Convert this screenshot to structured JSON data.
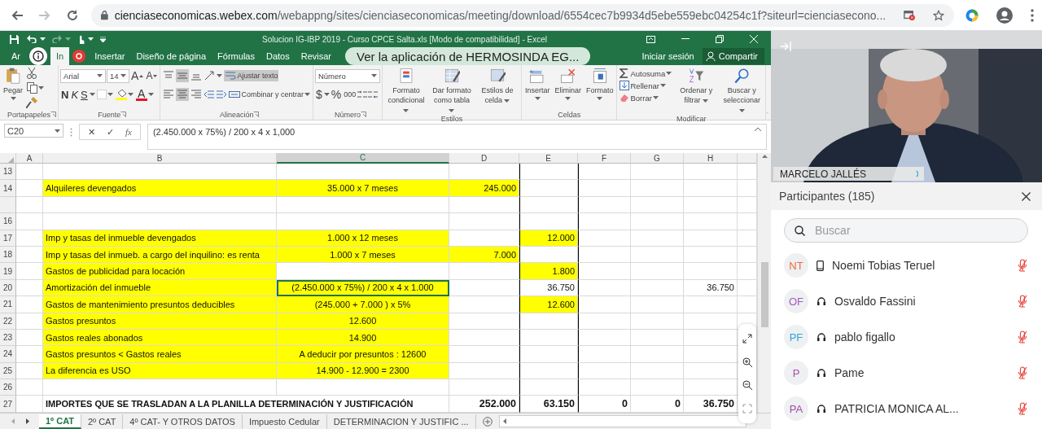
{
  "browser": {
    "nav": [
      {
        "kind": "back",
        "disabled": false
      },
      {
        "kind": "forward",
        "disabled": true
      },
      {
        "kind": "reload",
        "disabled": false
      }
    ],
    "url_host": "cienciaseconomicas.webex.com",
    "url_path": "/webappng/sites/cienciaseconomicas/meeting/download/6554cec7b9934d5ebe559ebc04254c1f?siteurl=cienciasecono..."
  },
  "excel": {
    "title": "Solucion  IG-IBP 2019 - Curso CPCE Salta.xls  [Modo de compatibilidad] - Excel",
    "tabs": [
      {
        "label": "Ar",
        "selected": false
      },
      {
        "label": "In",
        "selected": true
      },
      {
        "label": "Insertar",
        "selected": false
      },
      {
        "label": "Diseño de página",
        "selected": false
      },
      {
        "label": "Fórmulas",
        "selected": false
      },
      {
        "label": "Datos",
        "selected": false
      },
      {
        "label": "Revisar",
        "selected": false
      }
    ],
    "sign_in": "Iniciar sesión",
    "share": "Compartir",
    "ribbon": {
      "clipboard": {
        "paste": "Pegar",
        "group": "Portapapeles"
      },
      "font": {
        "family": "Arial",
        "size": "14",
        "grow": "A",
        "shrink": "A",
        "styles": [
          "N",
          "K",
          "S"
        ],
        "color_letter": "A",
        "group": "Fuente"
      },
      "alignment": {
        "vertical": [
          {
            "kind": "top",
            "selected": false
          },
          {
            "kind": "middle",
            "selected": true
          },
          {
            "kind": "bottom",
            "selected": false
          }
        ],
        "horizontal": [
          {
            "kind": "left",
            "selected": false
          },
          {
            "kind": "center",
            "selected": true
          },
          {
            "kind": "right",
            "selected": false
          }
        ],
        "wrap": {
          "label": "Ajustar texto",
          "on": true
        },
        "merge": "Combinar y centrar",
        "group": "Alineación"
      },
      "number": {
        "format": "Número",
        "symbols": [
          "$",
          "%",
          "000"
        ],
        "group": "Número"
      },
      "styles": {
        "buttons": [
          "Formato condicional",
          "Dar formato como tabla",
          "Estilos de celda"
        ],
        "group": "Estilos"
      },
      "cells": {
        "buttons": [
          "Insertar",
          "Eliminar",
          "Formato"
        ],
        "group": "Celdas"
      },
      "editing": {
        "small": [
          "Autosuma",
          "Rellenar",
          "Borrar"
        ],
        "buttons": [
          "Ordenar y filtrar",
          "Buscar y seleccionar"
        ],
        "group": "Modificar"
      }
    },
    "formula_bar": {
      "name_box": "C20",
      "cancel": "✕",
      "enter": "✓",
      "function": "fx",
      "formula": "(2.450.000 x 75%) / 200 x 4 x 1,000"
    },
    "columns": [
      {
        "label": "A",
        "selected": false
      },
      {
        "label": "B",
        "selected": false
      },
      {
        "label": "C",
        "selected": true
      },
      {
        "label": "D",
        "selected": false
      },
      {
        "label": "E",
        "selected": false
      },
      {
        "label": "F",
        "selected": false
      },
      {
        "label": "G",
        "selected": false
      },
      {
        "label": "H",
        "selected": false
      }
    ],
    "rows": [
      {
        "number": "13",
        "kind": "data"
      },
      {
        "number": "14",
        "kind": "data",
        "cells": [
          {
            "highlighted": false,
            "selected": false
          },
          {
            "text": "Alquileres devengados",
            "highlighted": true,
            "selected": false
          },
          {
            "text": "35.000  x 7 meses",
            "highlighted": true,
            "selected": false
          },
          {
            "text": "245.000",
            "highlighted": true,
            "selected": false
          }
        ]
      },
      {
        "kind": "data"
      },
      {
        "number": "16",
        "kind": "data"
      },
      {
        "number": "17",
        "kind": "data",
        "cells": [
          {
            "highlighted": false,
            "selected": false
          },
          {
            "text": "Imp y tasas del inmueble devengados",
            "highlighted": true,
            "selected": false
          },
          {
            "text": "1.000 x 12 meses",
            "highlighted": true,
            "selected": false
          },
          {
            "highlighted": false,
            "selected": false
          },
          {
            "text": "12.000",
            "highlighted": true,
            "selected": false
          }
        ]
      },
      {
        "number": "18",
        "kind": "data",
        "cells": [
          {
            "highlighted": false,
            "selected": false
          },
          {
            "text": "Imp y tasas del inmueb. a cargo del inquilino: es renta",
            "highlighted": true,
            "selected": false
          },
          {
            "text": "1.000 x 7 meses",
            "highlighted": true,
            "selected": false
          },
          {
            "text": "7.000",
            "highlighted": true,
            "selected": false
          }
        ]
      },
      {
        "number": "19",
        "kind": "data",
        "cells": [
          {
            "highlighted": false,
            "selected": false
          },
          {
            "text": "Gastos de publicidad para locación",
            "highlighted": true,
            "selected": false
          },
          {
            "highlighted": false,
            "selected": false
          },
          {
            "highlighted": false,
            "selected": false
          },
          {
            "text": "1.800",
            "highlighted": true,
            "selected": false
          }
        ]
      },
      {
        "number": "20",
        "kind": "data",
        "cells": [
          {
            "highlighted": false,
            "selected": false
          },
          {
            "text": "Amortización del inmueble",
            "highlighted": true,
            "selected": false
          },
          {
            "text": "(2.450.000 x 75%) / 200 x 4 x 1.000",
            "highlighted": true,
            "selected": true
          },
          {
            "highlighted": false,
            "selected": false
          },
          {
            "text": "36.750",
            "highlighted": false,
            "selected": false
          },
          {
            "highlighted": false,
            "selected": false
          },
          {
            "highlighted": false,
            "selected": false
          },
          {
            "text": "36.750",
            "highlighted": false,
            "selected": false
          }
        ]
      },
      {
        "number": "21",
        "kind": "data",
        "cells": [
          {
            "highlighted": false,
            "selected": false
          },
          {
            "text": "Gastos de mantenimiento presuntos deducibles",
            "highlighted": true,
            "selected": false
          },
          {
            "text": "(245.000 + 7.000 ) x 5%",
            "highlighted": true,
            "selected": false
          },
          {
            "highlighted": false,
            "selected": false
          },
          {
            "text": "12.600",
            "highlighted": true,
            "selected": false
          }
        ]
      },
      {
        "number": "22",
        "kind": "data",
        "cells": [
          {
            "highlighted": false,
            "selected": false
          },
          {
            "text": "Gastos presuntos",
            "highlighted": true,
            "selected": false
          },
          {
            "text": "12.600",
            "highlighted": true,
            "selected": false
          }
        ]
      },
      {
        "number": "23",
        "kind": "data",
        "cells": [
          {
            "highlighted": false,
            "selected": false
          },
          {
            "text": "Gastos reales abonados",
            "highlighted": true,
            "selected": false
          },
          {
            "text": "14.900",
            "highlighted": true,
            "selected": false
          }
        ]
      },
      {
        "number": "24",
        "kind": "data",
        "cells": [
          {
            "highlighted": false,
            "selected": false
          },
          {
            "text": "Gastos presuntos < Gastos reales",
            "highlighted": true,
            "selected": false
          },
          {
            "text": "A deducir por presuntos : 12600",
            "highlighted": true,
            "selected": false
          }
        ]
      },
      {
        "number": "25",
        "kind": "data",
        "cells": [
          {
            "highlighted": false,
            "selected": false
          },
          {
            "text": "La diferencia es USO",
            "highlighted": true,
            "selected": false
          },
          {
            "text": "14.900 - 12.900 = 2300",
            "highlighted": true,
            "selected": false
          }
        ]
      },
      {
        "number": "26",
        "kind": "data"
      },
      {
        "number": "27",
        "kind": "total",
        "cells": [
          {
            "highlighted": false,
            "selected": false
          },
          {
            "text": "IMPORTES QUE SE TRASLADAN A LA PLANILLA DETERMINACIÓN Y JUSTIFICACIÓN",
            "highlighted": false,
            "selected": false
          },
          {
            "text": "252.000",
            "highlighted": false,
            "selected": false
          },
          {
            "text": "63.150",
            "highlighted": false,
            "selected": false
          },
          {
            "text": "0",
            "highlighted": false,
            "selected": false
          },
          {
            "text": "0",
            "highlighted": false,
            "selected": false
          },
          {
            "text": "36.750",
            "highlighted": false,
            "selected": false
          }
        ]
      }
    ],
    "sheet_tabs": [
      {
        "label": "1º CAT",
        "selected": true
      },
      {
        "label": "2º CAT",
        "selected": false
      },
      {
        "label": "4º CAT- Y OTROS DATOS",
        "selected": false
      },
      {
        "label": "Impuesto Cedular",
        "selected": false
      },
      {
        "label": "DETERMINACION Y JUSTIFIC ...",
        "selected": false
      }
    ]
  },
  "toast": "Ver la aplicación de HERMOSINDA EG...",
  "meeting": {
    "speaker": "MARCELO JALLÉS",
    "participants_title": "Participantes (185)",
    "search": {
      "placeholder": "Buscar"
    },
    "participants": [
      {
        "initials": "NT",
        "color": "#f26b3a",
        "kind": "phone",
        "name": "Noemi Tobias Teruel",
        "muted": true
      },
      {
        "initials": "OF",
        "color": "#a35bb8",
        "kind": "headset",
        "name": "Osvaldo Fassini",
        "muted": true
      },
      {
        "initials": "PF",
        "color": "#2fa4de",
        "kind": "headset",
        "name": "pablo figallo",
        "muted": true
      },
      {
        "initials": "P",
        "color": "#b04db2",
        "kind": "headset",
        "name": "Pame",
        "muted": true
      },
      {
        "initials": "PA",
        "color": "#a64aa8",
        "kind": "headset",
        "name": "PATRICIA MONICA AL...",
        "muted": true
      }
    ]
  }
}
